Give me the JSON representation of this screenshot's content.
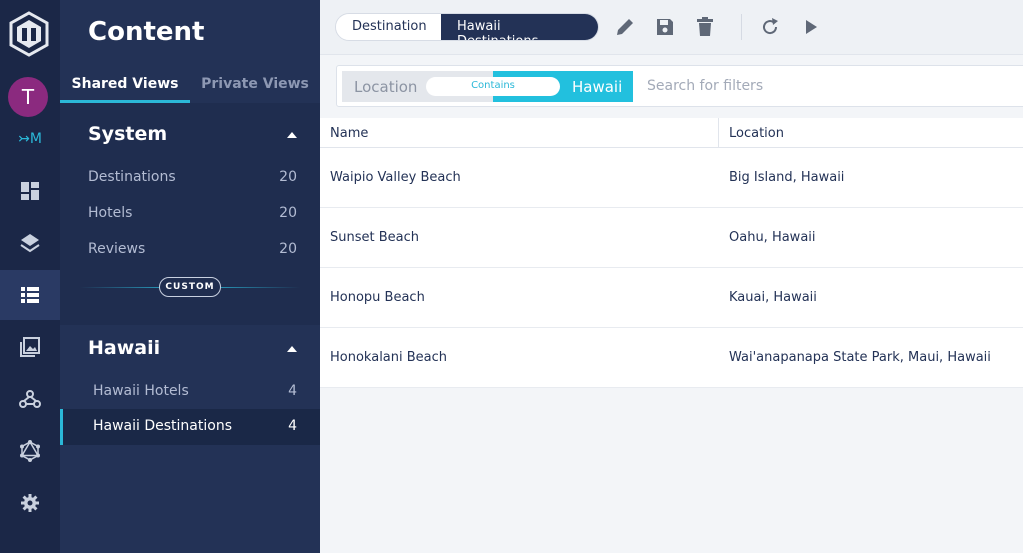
{
  "rail": {
    "avatar_initial": "T",
    "brand_mark": "↣M"
  },
  "panel": {
    "title": "Content",
    "tabs": [
      {
        "label": "Shared Views",
        "active": true
      },
      {
        "label": "Private Views",
        "active": false
      }
    ],
    "system": {
      "title": "System",
      "items": [
        {
          "label": "Destinations",
          "count": "20"
        },
        {
          "label": "Hotels",
          "count": "20"
        },
        {
          "label": "Reviews",
          "count": "20"
        }
      ]
    },
    "custom_label": "CUSTOM",
    "hawaii": {
      "title": "Hawaii",
      "items": [
        {
          "label": "Hawaii Hotels",
          "count": "4",
          "active": false
        },
        {
          "label": "Hawaii Destinations",
          "count": "4",
          "active": true
        }
      ]
    }
  },
  "toolbar": {
    "segments": [
      "Destination",
      "Hawaii Destinations"
    ]
  },
  "filter": {
    "field": "Location",
    "operator": "Contains",
    "value": "Hawaii",
    "search_placeholder": "Search for filters"
  },
  "table": {
    "columns": [
      "Name",
      "Location"
    ],
    "rows": [
      [
        "Waipio Valley Beach",
        "Big Island, Hawaii"
      ],
      [
        "Sunset Beach",
        "Oahu, Hawaii"
      ],
      [
        "Honopu Beach",
        "Kauai, Hawaii"
      ],
      [
        "Honokalani Beach",
        "Wai'anapanapa State Park, Maui, Hawaii"
      ]
    ]
  },
  "colors": {
    "rail_bg": "#1b2747",
    "panel_bg": "#233256",
    "accent": "#2bb8d8",
    "avatar": "#8b2a7f"
  }
}
